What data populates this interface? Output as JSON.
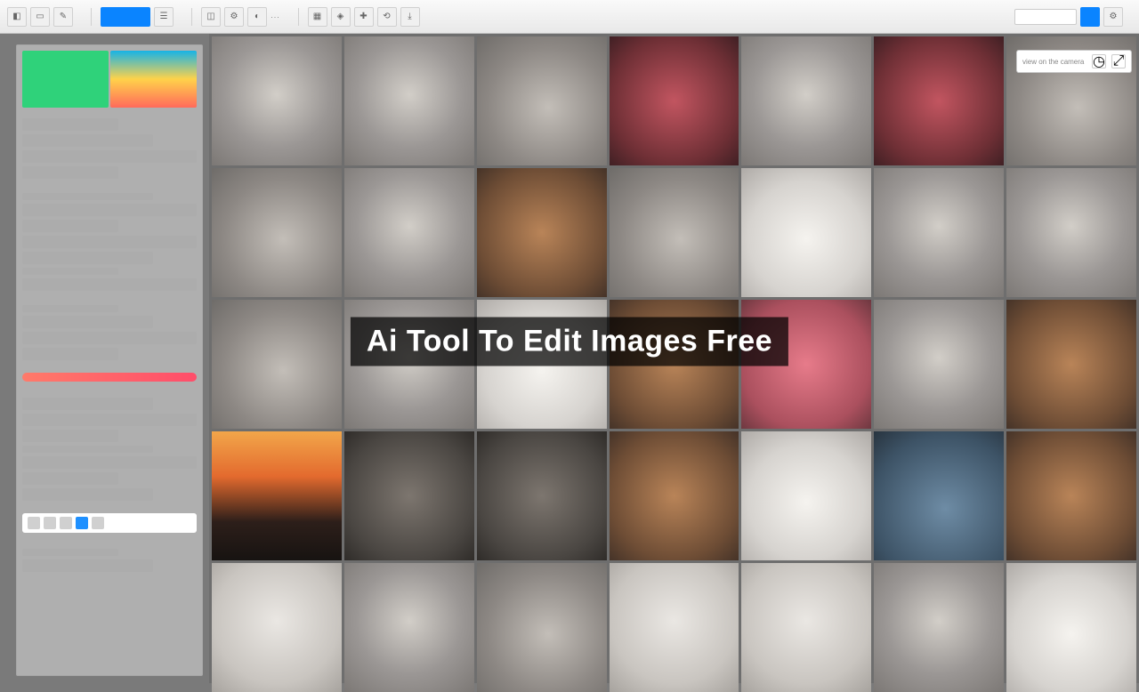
{
  "overlay": {
    "title": "Ai Tool To Edit Images Free"
  },
  "right_float": {
    "label": "view on the camera"
  },
  "toolbar": {
    "groups": [
      [
        "home-icon",
        "doc-icon",
        "pen-icon"
      ],
      [
        "layers-icon",
        "grid-icon"
      ],
      [
        "edit-icon",
        "crop-icon",
        "adjust-icon"
      ],
      [
        "undo-icon",
        "redo-icon"
      ],
      [
        "tool-a",
        "tool-b",
        "tool-c",
        "tool-d"
      ],
      [
        "export-icon",
        "share-icon"
      ]
    ]
  },
  "sidebar": {
    "swatches": [
      "#2fd27a",
      "#17b3e6",
      "#ffd24a",
      "#ff6a5b"
    ],
    "sections": 5
  },
  "grid": {
    "rows": 5,
    "cols": 7,
    "thumbs": [
      "t-gray",
      "t-gray",
      "t-gray2",
      "t-red",
      "t-gray",
      "t-red",
      "t-gray2",
      "t-gray2",
      "t-gray",
      "t-brown",
      "t-gray2",
      "t-white",
      "t-gray",
      "t-gray",
      "t-gray2",
      "t-gray",
      "t-white",
      "t-brown",
      "t-pink",
      "t-gray",
      "t-brown",
      "t-sunset",
      "t-dark",
      "t-dark",
      "t-brown",
      "t-white",
      "t-blue",
      "t-brown",
      "t-light",
      "t-gray",
      "t-gray2",
      "t-light",
      "t-light",
      "t-gray",
      "t-white"
    ]
  }
}
